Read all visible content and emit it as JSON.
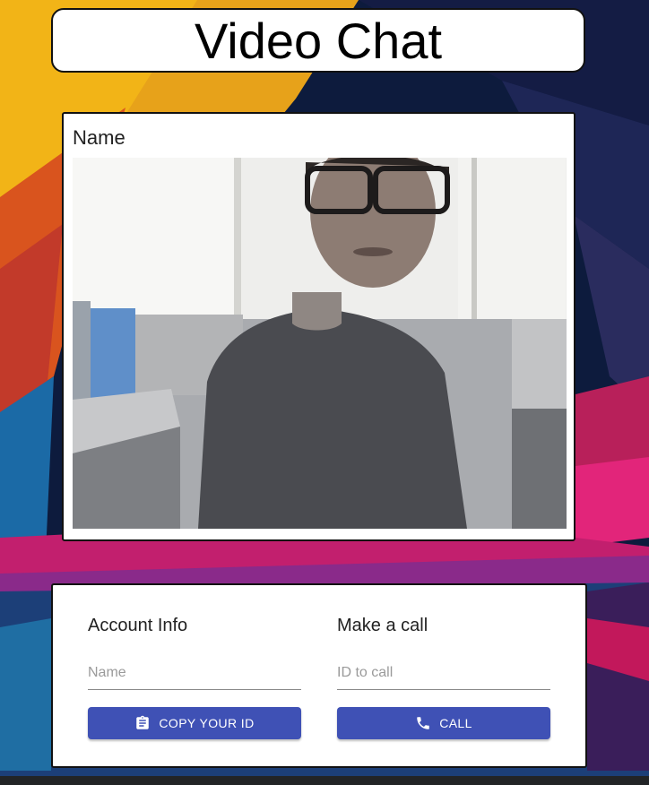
{
  "page": {
    "title": "Video Chat"
  },
  "video": {
    "label": "Name"
  },
  "account": {
    "heading": "Account Info",
    "name_placeholder": "Name",
    "name_value": "",
    "copy_button_label": "COPY YOUR ID",
    "copy_icon": "clipboard-icon"
  },
  "call": {
    "heading": "Make a call",
    "id_placeholder": "ID to call",
    "id_value": "",
    "call_button_label": "CALL",
    "call_icon": "phone-icon"
  },
  "colors": {
    "primary_button": "#3f51b5",
    "card_background": "#ffffff",
    "card_border": "#111111"
  }
}
